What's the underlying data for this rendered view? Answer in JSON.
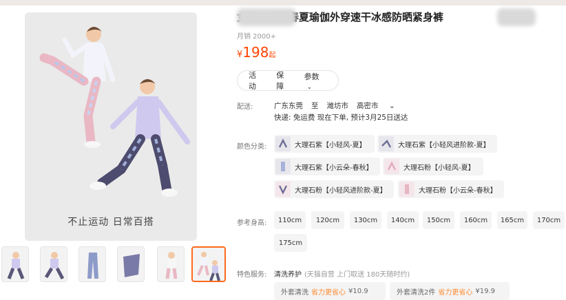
{
  "product": {
    "title": "女童运动裤春夏瑜伽外穿速干冰感防晒紧身裤",
    "sales": "月销 2000+",
    "price_currency": "¥",
    "price_value": "198",
    "price_suffix": "起"
  },
  "gallery": {
    "caption": "不止运动 日常百搭",
    "thumbs": [
      {
        "name": "thumb-1"
      },
      {
        "name": "thumb-2"
      },
      {
        "name": "thumb-3"
      },
      {
        "name": "thumb-4"
      },
      {
        "name": "thumb-5"
      },
      {
        "name": "thumb-6"
      }
    ],
    "active_thumb": 5
  },
  "tabs": [
    "活动",
    "保障",
    "参数"
  ],
  "tabs_chevron_icon": "chevron-down-icon",
  "delivery": {
    "label": "配送:",
    "from": "广东东莞",
    "to_word": "至",
    "dest_city": "潍坊市",
    "dest_district": "高密市",
    "line2": "快递: 免运费  现在下单, 预计3月25日送达"
  },
  "colors": {
    "label": "颜色分类:",
    "options": [
      "大理石紫【小轻风-夏】",
      "大理石紫【小轻风进阶款-夏】",
      "大理石紫【小云朵-春秋】",
      "大理石粉【小轻风-夏】",
      "大理石粉【小轻风进阶款-夏】",
      "大理石粉【小云朵-春秋】"
    ]
  },
  "sizes": {
    "label": "参考身高:",
    "options": [
      "110cm",
      "120cm",
      "130cm",
      "140cm",
      "150cm",
      "160cm",
      "165cm",
      "170cm",
      "175cm"
    ]
  },
  "service": {
    "label": "特色服务:",
    "main": "清洗养护",
    "note": "(天猫自营 上门取送 180天随时约)",
    "chips": [
      {
        "name": "外套清洗",
        "promo": "省力更省心",
        "price": "¥10.9"
      },
      {
        "name": "外套清洗2件",
        "promo": "省力更省心",
        "price": "¥19.9"
      }
    ]
  },
  "colors_theme": {
    "price": "#ff4400",
    "accent": "#ff6a1a"
  }
}
